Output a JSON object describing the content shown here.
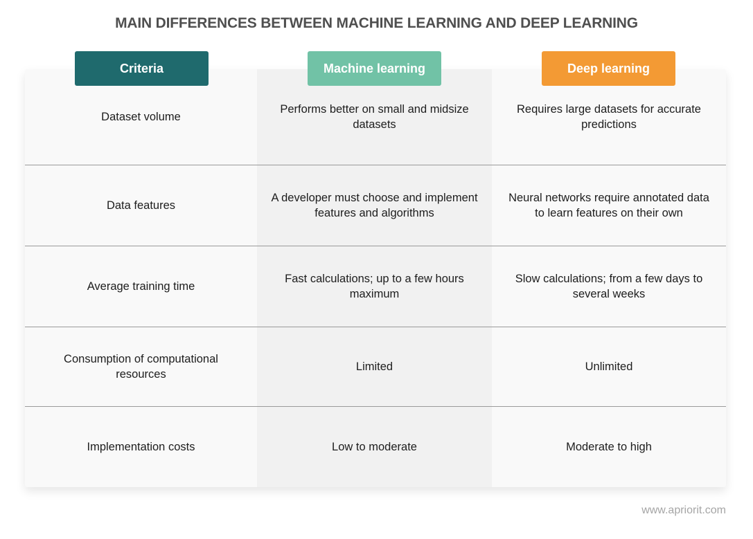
{
  "title": "MAIN DIFFERENCES BETWEEN MACHINE LEARNING AND DEEP LEARNING",
  "colors": {
    "criteria": "#1f6a6d",
    "machine_learning": "#71c2a6",
    "deep_learning": "#f39a34"
  },
  "headers": [
    "Criteria",
    "Machine learning",
    "Deep learning"
  ],
  "rows": [
    {
      "criteria": "Dataset volume",
      "machine_learning": "Performs better on small and midsize datasets",
      "deep_learning": "Requires large datasets for accurate predictions"
    },
    {
      "criteria": "Data features",
      "machine_learning": "A developer must choose and implement features and algorithms",
      "deep_learning": "Neural networks require annotated data to learn features on their own"
    },
    {
      "criteria": "Average training time",
      "machine_learning": "Fast calculations; up to a few hours maximum",
      "deep_learning": "Slow calculations; from a few days to several weeks"
    },
    {
      "criteria": "Consumption of computational resources",
      "machine_learning": "Limited",
      "deep_learning": "Unlimited"
    },
    {
      "criteria": "Implementation costs",
      "machine_learning": "Low to moderate",
      "deep_learning": "Moderate to high"
    }
  ],
  "footer": "www.apriorit.com"
}
